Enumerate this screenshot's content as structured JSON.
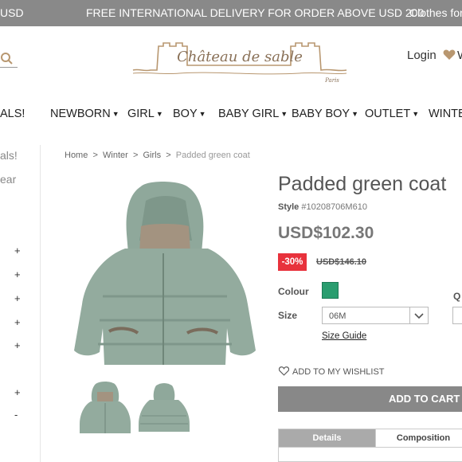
{
  "topbar": {
    "currency": "USD",
    "promo": "FREE INTERNATIONAL DELIVERY FOR ORDER ABOVE USD 200",
    "right_text": "Clothes for"
  },
  "header": {
    "logo_text": "Château de sable",
    "logo_sub": "Paris",
    "login": "Login",
    "wishlist_initial": "W"
  },
  "nav": {
    "items": [
      "ALS!",
      "NEWBORN",
      "GIRL",
      "BOY",
      "BABY GIRL",
      "BABY BOY",
      "OUTLET",
      "WINTE"
    ]
  },
  "sidebar": {
    "items": [
      "als!",
      "ear"
    ],
    "toggles": [
      "+",
      "+",
      "+",
      "+",
      "+",
      "+",
      "-"
    ]
  },
  "breadcrumb": {
    "home": "Home",
    "sep": ">",
    "winter": "Winter",
    "girls": "Girls",
    "current": "Padded green coat"
  },
  "product": {
    "name": "Padded green coat",
    "style_label": "Style",
    "style_value": "#10208706M610",
    "price": "USD$102.30",
    "discount": "-30%",
    "old_price": "USD$146.10",
    "colour_label": "Colour",
    "colour_hex": "#2a9d6f",
    "size_label": "Size",
    "size_value": "06M",
    "size_guide": "Size Guide",
    "qty_label": "Q",
    "wishlist": "ADD TO MY WISHLIST",
    "add_to_cart": "ADD TO CART",
    "tabs": [
      "Details",
      "Composition"
    ]
  }
}
